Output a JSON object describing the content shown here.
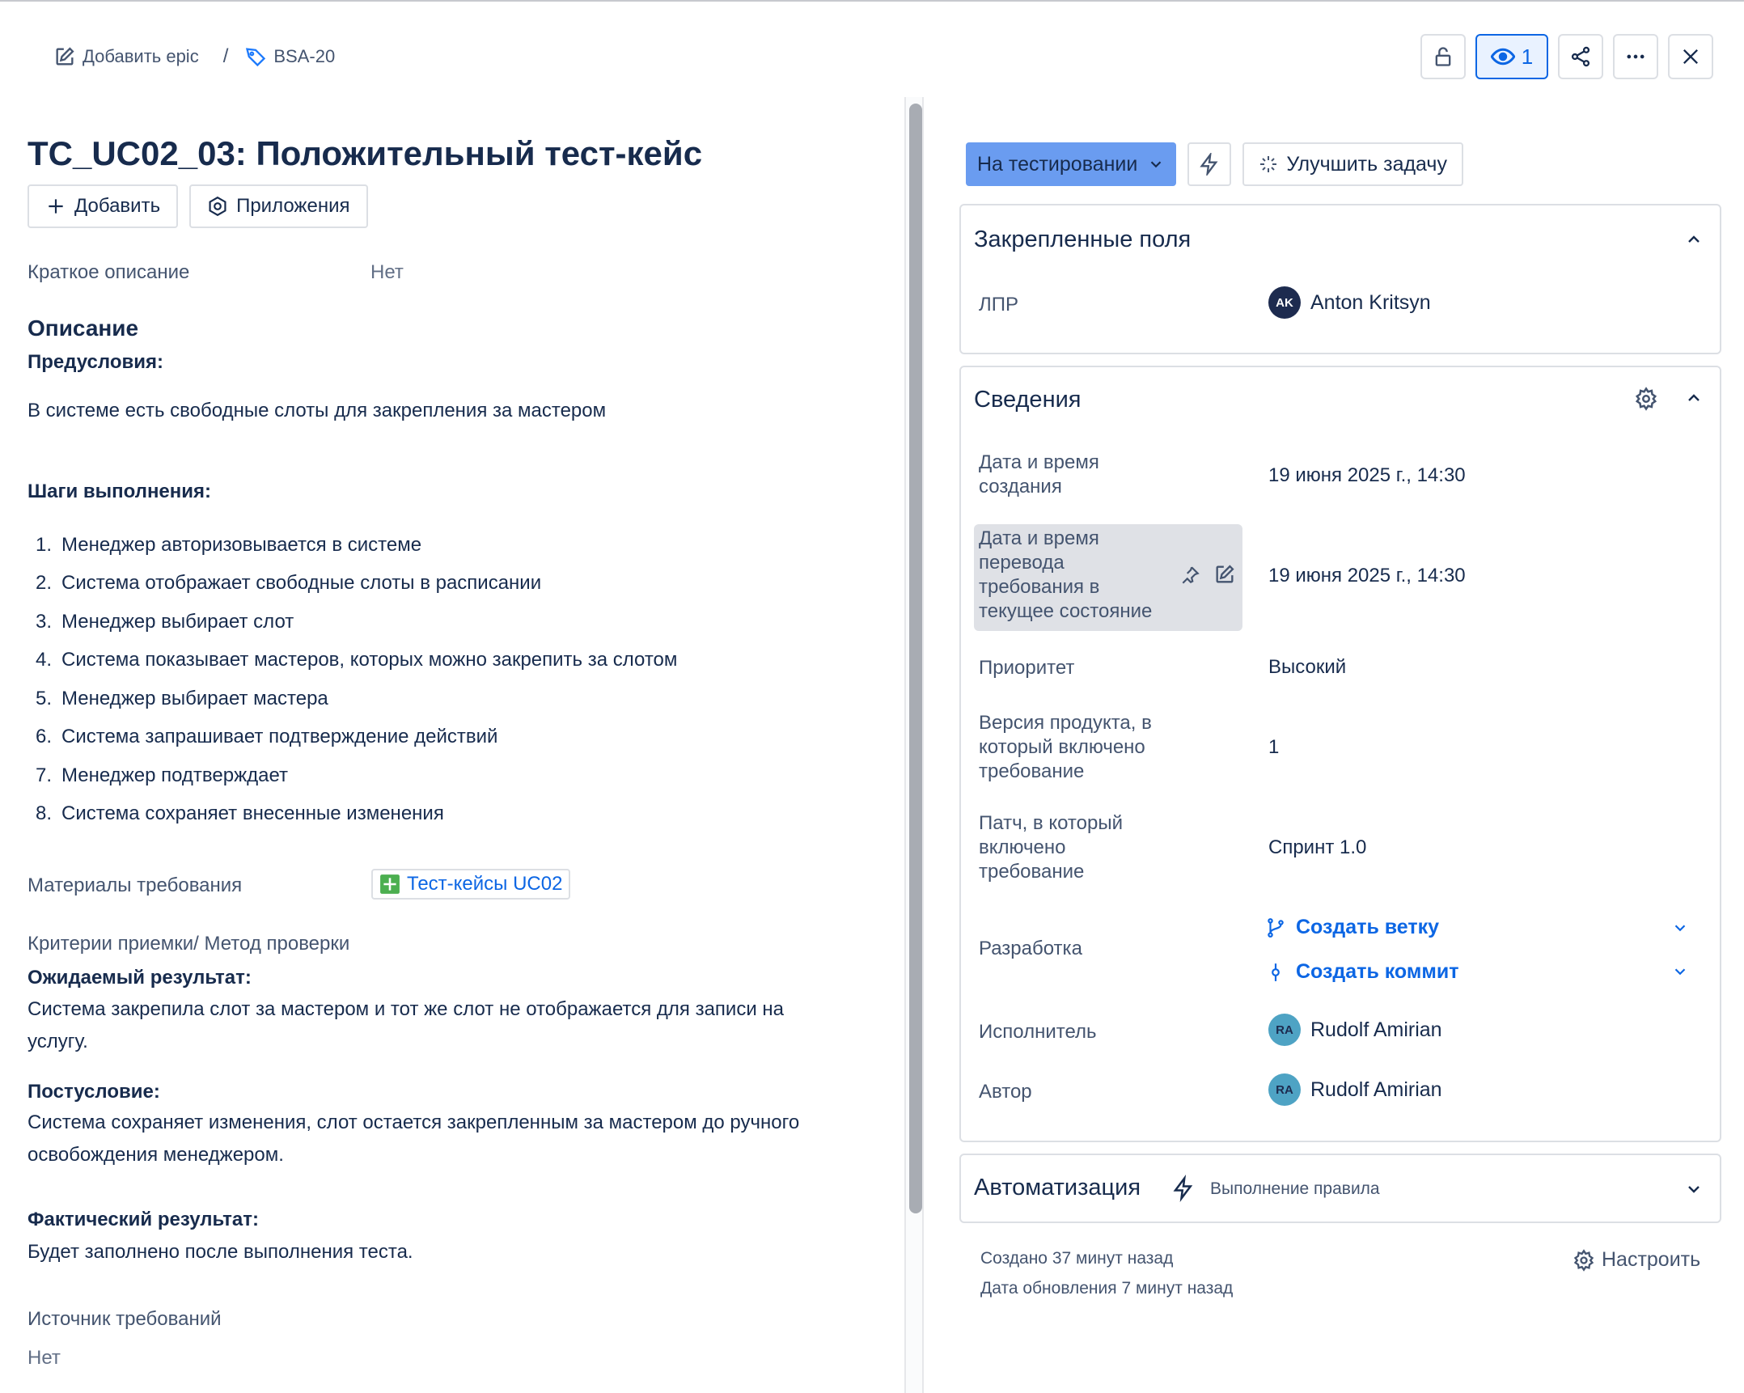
{
  "breadcrumb": {
    "add_epic": "Добавить epic",
    "separator": "/",
    "issue_key": "BSA-20"
  },
  "top_actions": {
    "watch_count": "1",
    "icons": [
      "lock-open-icon",
      "eye-icon",
      "share-icon",
      "more-icon",
      "close-icon"
    ]
  },
  "issue": {
    "title": "TC_UC02_03: Положительный тест-кейс",
    "add_button": "Добавить",
    "apps_button": "Приложения",
    "short_desc_label": "Краткое описание",
    "short_desc_value": "Нет",
    "description_heading": "Описание",
    "preconditions_label": "Предусловия:",
    "preconditions_text": "В системе есть свободные слоты для закрепления за мастером",
    "steps_label": "Шаги выполнения:",
    "steps": [
      {
        "num": "1.",
        "text": "Менеджер авторизовывается в системе"
      },
      {
        "num": "2.",
        "text": "Система отображает свободные слоты в расписании"
      },
      {
        "num": "3.",
        "text": "Менеджер выбирает слот"
      },
      {
        "num": "4.",
        "text": "Система показывает мастеров, которых можно закрепить за слотом"
      },
      {
        "num": "5.",
        "text": "Менеджер выбирает мастера"
      },
      {
        "num": "6.",
        "text": "Система запрашивает подтверждение действий"
      },
      {
        "num": "7.",
        "text": "Менеджер подтверждает"
      },
      {
        "num": "8.",
        "text": "Система сохраняет внесенные изменения"
      }
    ],
    "materials_label": "Материалы требования",
    "materials_link": "Тест-кейсы UC02",
    "criteria_label": "Критерии приемки/ Метод проверки",
    "expected_label": "Ожидаемый результат:",
    "expected_line1": "Система закрепила слот за мастером и тот же слот не отображается для записи на",
    "expected_line2": "услугу.",
    "post_label": "Постусловие:",
    "post_line1": "Система сохраняет изменения, слот остается закрепленным за мастером до ручного",
    "post_line2": "освобождения менеджером.",
    "actual_label": "Фактический результат:",
    "actual_text": "Будет заполнено после выполнения теста.",
    "source_label": "Источник требований",
    "source_value": "Нет"
  },
  "sidebar": {
    "status": "На тестировании",
    "improve_button": "Улучшить задачу",
    "pinned": {
      "title": "Закрепленные поля",
      "lpr_label": "ЛПР",
      "lpr_initials": "AK",
      "lpr_name": "Anton Kritsyn"
    },
    "details": {
      "title": "Сведения",
      "created_label_1": "Дата и время",
      "created_label_2": "создания",
      "created_value": "19 июня 2025 г., 14:30",
      "transition_label_1": "Дата и время",
      "transition_label_2": "перевода",
      "transition_label_3": "требования в",
      "transition_label_4": "текущее состояние",
      "transition_value": "19 июня 2025 г., 14:30",
      "priority_label": "Приоритет",
      "priority_value": "Высокий",
      "version_label_1": "Версия продукта, в",
      "version_label_2": "который включено",
      "version_label_3": "требование",
      "version_value": "1",
      "patch_label_1": "Патч, в который",
      "patch_label_2": "включено",
      "patch_label_3": "требование",
      "patch_value": "Спринт 1.0",
      "dev_label": "Разработка",
      "create_branch": "Создать ветку",
      "create_commit": "Создать коммит",
      "assignee_label": "Исполнитель",
      "assignee_initials": "RA",
      "assignee_name": "Rudolf Amirian",
      "author_label": "Автор",
      "author_initials": "RA",
      "author_name": "Rudolf Amirian"
    },
    "automation": {
      "title": "Автоматизация",
      "subtitle": "Выполнение правила"
    },
    "created_meta": "Создано 37 минут назад",
    "updated_meta": "Дата обновления 7 минут назад",
    "configure": "Настроить"
  },
  "colors": {
    "status_bg": "#6a9cf0",
    "link": "#0c66e4",
    "avatar_dark": "#1d2b4f",
    "avatar_teal": "#4ea3c4",
    "sheet_green": "#4caf50"
  }
}
